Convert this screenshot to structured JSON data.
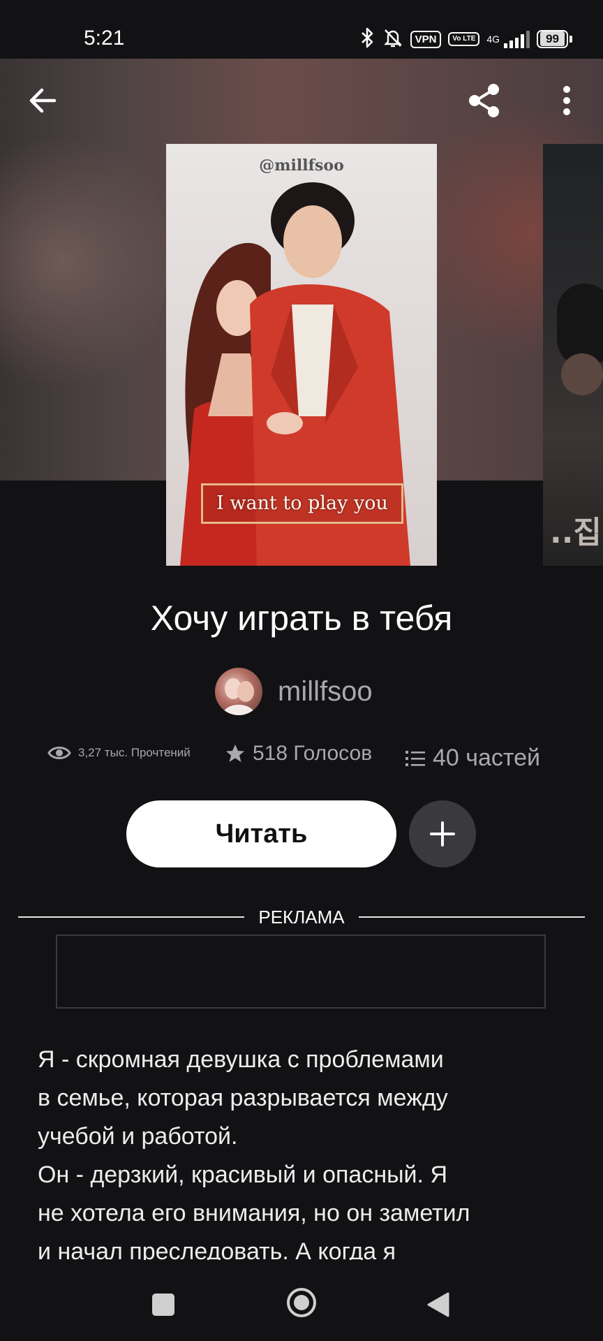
{
  "status_bar": {
    "time": "5:21",
    "vpn_badge": "VPN",
    "volte_badge": "Vo LTE",
    "network_type": "4G",
    "battery_level": "99"
  },
  "toolbar": {
    "back_icon": "arrow-left-icon",
    "share_icon": "share-icon",
    "more_icon": "more-vertical-icon"
  },
  "cover": {
    "watermark": "@millfsoo",
    "caption": "I want to play you"
  },
  "next_cover": {
    "glyph": "..집"
  },
  "story": {
    "title": "Хочу играть в тебя",
    "author": "millfsoo"
  },
  "stats": {
    "reads": "3,27 тыс. Прочтений",
    "votes": "518 Голосов",
    "parts": "40 частей"
  },
  "actions": {
    "read_label": "Читать",
    "add_icon": "plus-icon"
  },
  "ad": {
    "label": "РЕКЛАМА"
  },
  "description": {
    "lines": [
      "Я - скромная девушка с проблемами",
      "в семье, которая разрывается между",
      "учебой и работой.",
      "Он - дерзкий, красивый и опасный. Я",
      "не хотела его внимания, но он заметил",
      "и начал преследовать. А когда я"
    ]
  },
  "colors": {
    "background": "#121214",
    "muted_text": "#a9a9ad",
    "button_bg": "#ffffff",
    "add_button_bg": "#3a3a3e"
  }
}
